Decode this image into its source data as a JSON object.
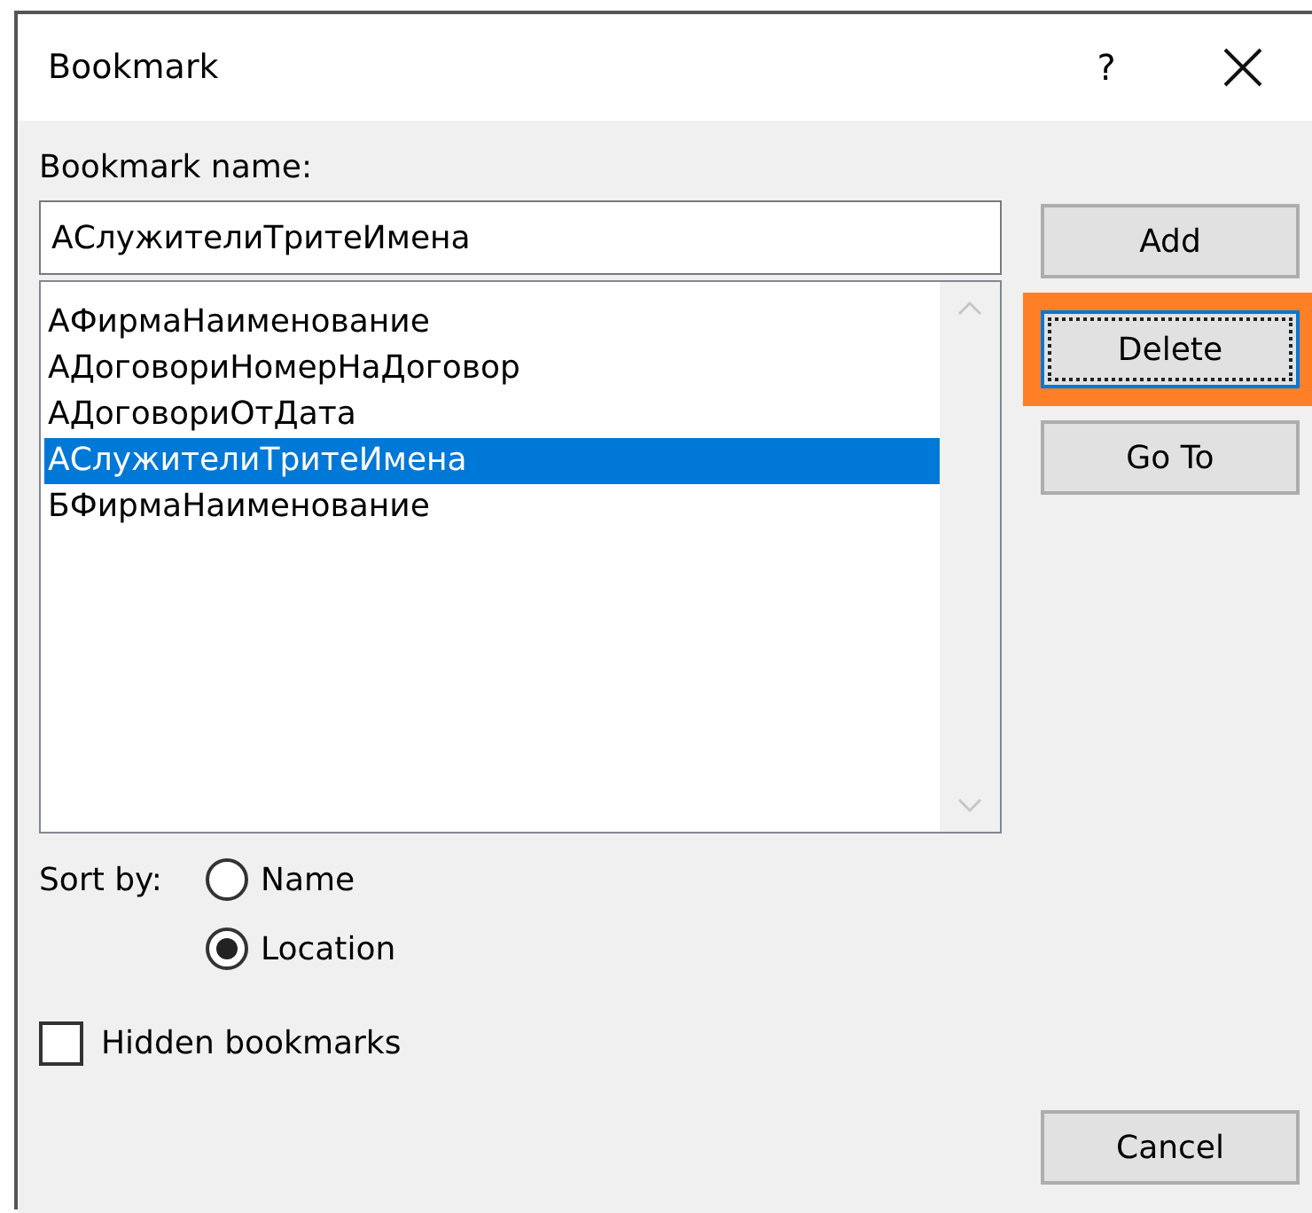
{
  "window": {
    "title": "Bookmark",
    "help": "?"
  },
  "name_label": "Bookmark name:",
  "name_field": {
    "value": "АСлужителиТритеИмена"
  },
  "bookmarks": [
    {
      "label": "АФирмаНаименование",
      "selected": false
    },
    {
      "label": "АДоговориНомерНаДоговор",
      "selected": false
    },
    {
      "label": "АДоговориОтДата",
      "selected": false
    },
    {
      "label": "АСлужителиТритеИмена",
      "selected": true
    },
    {
      "label": "БФирмаНаименование",
      "selected": false
    }
  ],
  "buttons": [
    {
      "label": "Add",
      "focused": false,
      "highlighted": false
    },
    {
      "label": "Delete",
      "focused": true,
      "highlighted": true
    },
    {
      "label": "Go To",
      "focused": false,
      "highlighted": false
    }
  ],
  "sort": {
    "label": "Sort by:",
    "options": [
      {
        "label": "Name",
        "selected": false
      },
      {
        "label": "Location",
        "selected": true
      }
    ]
  },
  "hidden_bookmarks": {
    "label": "Hidden bookmarks",
    "checked": false
  },
  "cancel": {
    "label": "Cancel"
  }
}
